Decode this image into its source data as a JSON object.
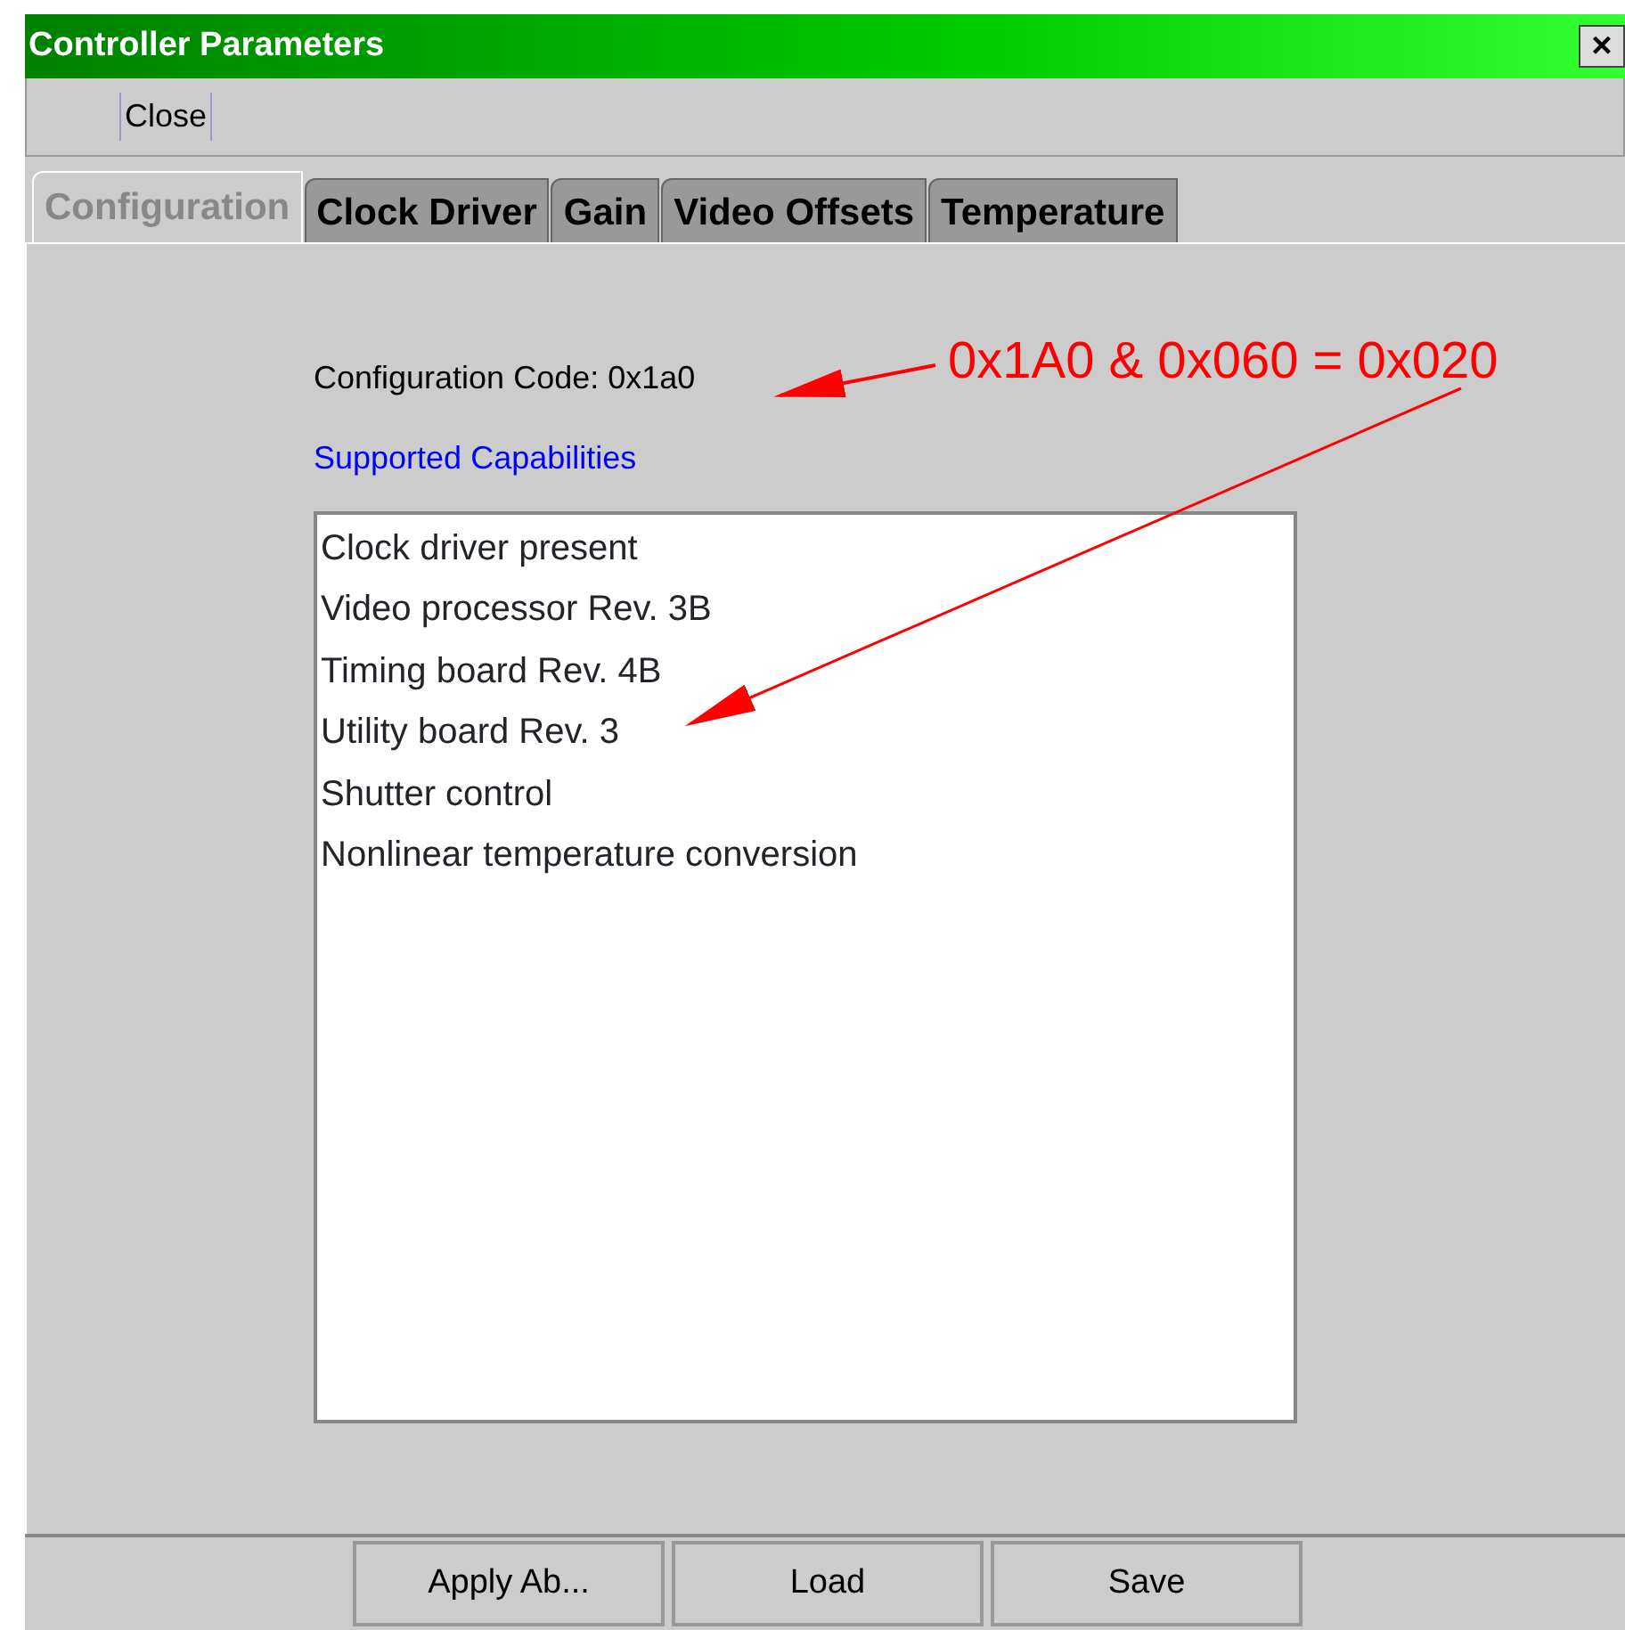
{
  "window": {
    "title": "Controller Parameters",
    "close_glyph": "×"
  },
  "menu": [
    "Close"
  ],
  "tabs": [
    {
      "label": "Configuration",
      "selected": true
    },
    {
      "label": "Clock Driver",
      "selected": false
    },
    {
      "label": "Gain",
      "selected": false
    },
    {
      "label": "Video Offsets",
      "selected": false
    },
    {
      "label": "Temperature",
      "selected": false
    }
  ],
  "configuration_code": "Configuration Code: 0x1a0",
  "capabilities_heading": "Supported Capabilities",
  "capabilities": [
    "Clock driver present",
    "Video processor Rev. 3B",
    "Timing board Rev. 4B",
    "Utility board Rev. 3",
    "Shutter control",
    "Nonlinear temperature conversion"
  ],
  "annotation": "0x1A0 & 0x060 = 0x020",
  "buttons": [
    "Apply Ab...",
    "Load",
    "Save"
  ]
}
